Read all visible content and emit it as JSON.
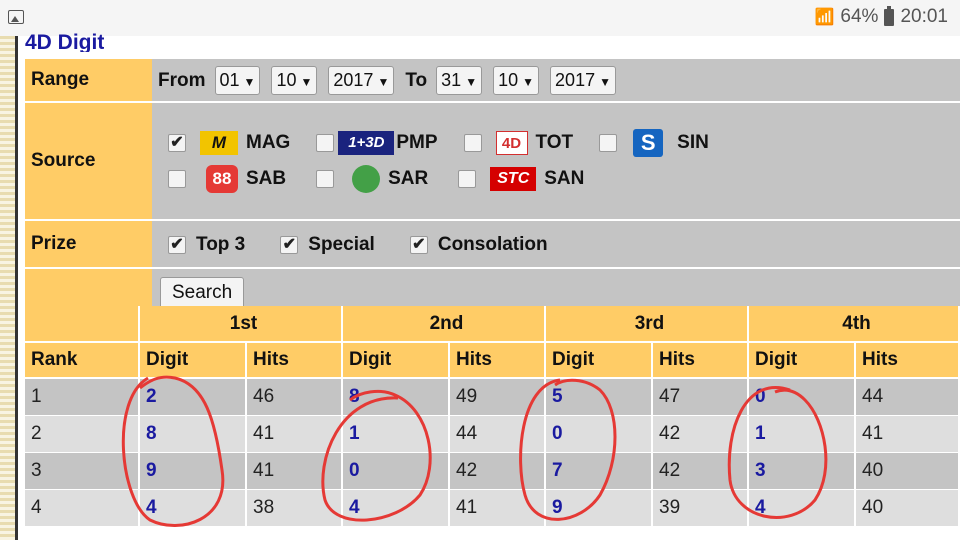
{
  "status_bar": {
    "battery": "64%",
    "time": "20:01"
  },
  "page": {
    "title": "4D Digit"
  },
  "form": {
    "range": {
      "label": "Range",
      "from_label": "From",
      "to_label": "To",
      "from_day": "01",
      "from_month": "10",
      "from_year": "2017",
      "to_day": "31",
      "to_month": "10",
      "to_year": "2017"
    },
    "source": {
      "label": "Source",
      "items": [
        {
          "logo": "M",
          "name": "MAG",
          "checked": true,
          "color": "#f2c400"
        },
        {
          "logo": "1+3D",
          "name": "PMP",
          "checked": false,
          "color": "#1a237e"
        },
        {
          "logo": "4D",
          "name": "TOT",
          "checked": false,
          "color": "#d32f2f"
        },
        {
          "logo": "S",
          "name": "SIN",
          "checked": false,
          "color": "#1565c0"
        },
        {
          "logo": "88",
          "name": "SAB",
          "checked": false,
          "color": "#e53935"
        },
        {
          "logo": "",
          "name": "SAR",
          "checked": false,
          "color": "#43a047"
        },
        {
          "logo": "STC",
          "name": "SAN",
          "checked": false,
          "color": "#d50000"
        }
      ]
    },
    "prize": {
      "label": "Prize",
      "items": [
        {
          "name": "Top 3",
          "checked": true
        },
        {
          "name": "Special",
          "checked": true
        },
        {
          "name": "Consolation",
          "checked": true
        }
      ]
    },
    "search_button": "Search"
  },
  "results": {
    "groups": [
      "1st",
      "2nd",
      "3rd",
      "4th"
    ],
    "rank_header": "Rank",
    "digit_header": "Digit",
    "hits_header": "Hits",
    "rows": [
      {
        "rank": "1",
        "cells": [
          [
            "2",
            "46"
          ],
          [
            "8",
            "49"
          ],
          [
            "5",
            "47"
          ],
          [
            "0",
            "44"
          ]
        ]
      },
      {
        "rank": "2",
        "cells": [
          [
            "8",
            "41"
          ],
          [
            "1",
            "44"
          ],
          [
            "0",
            "42"
          ],
          [
            "1",
            "41"
          ]
        ]
      },
      {
        "rank": "3",
        "cells": [
          [
            "9",
            "41"
          ],
          [
            "0",
            "42"
          ],
          [
            "7",
            "42"
          ],
          [
            "3",
            "40"
          ]
        ]
      },
      {
        "rank": "4",
        "cells": [
          [
            "4",
            "38"
          ],
          [
            "4",
            "41"
          ],
          [
            "9",
            "39"
          ],
          [
            "4",
            "40"
          ]
        ]
      }
    ]
  },
  "colors": {
    "header": "#ffcc66",
    "row_dark": "#c4c4c4",
    "row_light": "#dedede",
    "digit": "#1a1aa0",
    "annotation": "#e53935"
  }
}
